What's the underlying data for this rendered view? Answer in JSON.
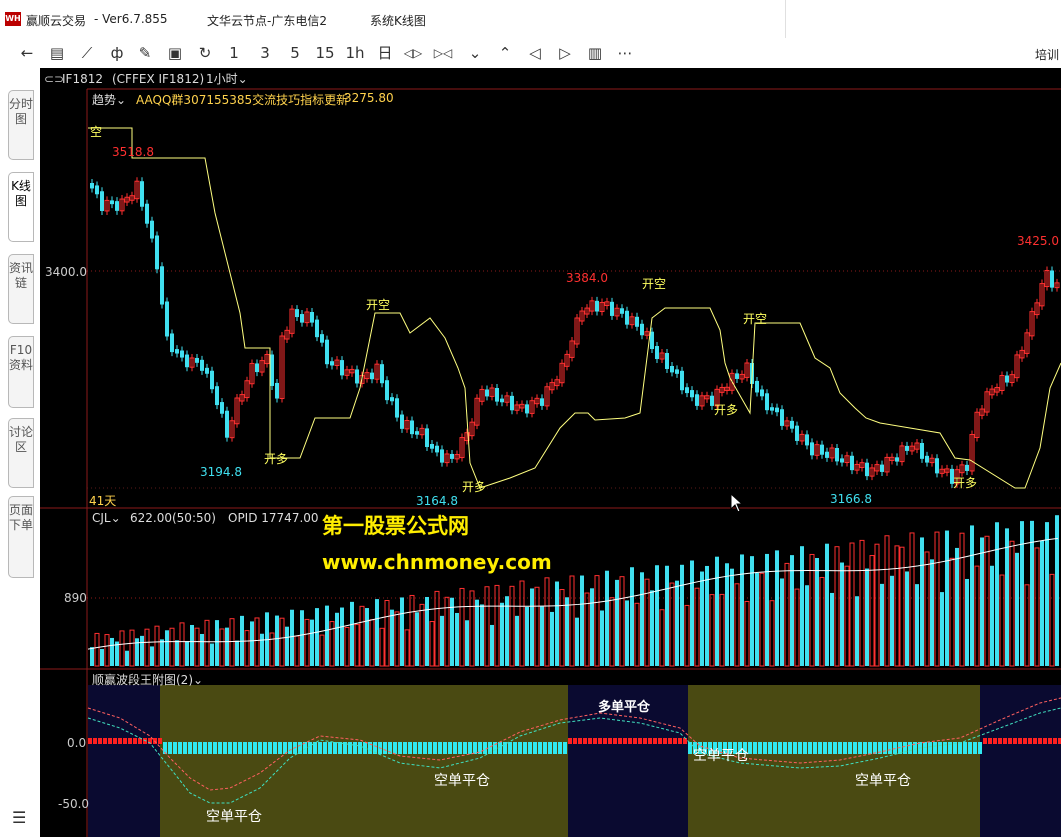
{
  "window": {
    "app_title": "赢顺云交易",
    "version_label": "-  Ver6.7.855",
    "node_label": "文华云节点-广东电信2",
    "system_label": "系统K线图",
    "logo_text": "WH"
  },
  "toolbar": {
    "buttons": [
      {
        "name": "back-arrow-icon",
        "label": "←"
      },
      {
        "name": "list-icon",
        "label": "▤"
      },
      {
        "name": "line-chart-icon",
        "label": "⟋"
      },
      {
        "name": "candlestick-icon",
        "label": "ф"
      },
      {
        "name": "draw-tool-icon",
        "label": "✎"
      },
      {
        "name": "save-icon",
        "label": "▣"
      },
      {
        "name": "refresh-icon",
        "label": "↻"
      },
      {
        "name": "period-1-button",
        "label": "1"
      },
      {
        "name": "period-3-button",
        "label": "3"
      },
      {
        "name": "period-5-button",
        "label": "5"
      },
      {
        "name": "period-15-button",
        "label": "15"
      },
      {
        "name": "period-1h-button",
        "label": "1h"
      },
      {
        "name": "period-day-button",
        "label": "日"
      },
      {
        "name": "zoom-out-icon",
        "label": "◁▷"
      },
      {
        "name": "zoom-in-icon",
        "label": "▷◁"
      },
      {
        "name": "chevron-down-icon",
        "label": "⌄"
      },
      {
        "name": "chevron-up-icon",
        "label": "⌃"
      },
      {
        "name": "prev-icon",
        "label": "◁"
      },
      {
        "name": "next-icon",
        "label": "▷"
      },
      {
        "name": "layout-icon",
        "label": "▥"
      },
      {
        "name": "more-icon",
        "label": "⋯"
      }
    ],
    "right_label": "培训"
  },
  "left_tabs": [
    {
      "label": "分时图",
      "active": false
    },
    {
      "label": "K线图",
      "active": true
    },
    {
      "label": "资讯链",
      "active": false
    },
    {
      "label": "F10资料",
      "active": false
    },
    {
      "label": "讨论区",
      "active": false
    },
    {
      "label": "页面下单",
      "active": false
    }
  ],
  "symbol_bar": {
    "code": "IF1812",
    "market": "(CFFEX IF1812)",
    "period": "1小时"
  },
  "main_panel": {
    "indicator": "趋势",
    "info": "AAQQ群307155385交流技巧指标更新",
    "value": "3275.80",
    "y_label": "3400.0",
    "period_count": "41天",
    "price_labels": [
      {
        "text": "3518.8",
        "color": "#ff3030"
      },
      {
        "text": "3194.8",
        "color": "#40e0f0"
      },
      {
        "text": "3164.8",
        "color": "#40e0f0"
      },
      {
        "text": "3384.0",
        "color": "#ff3030"
      },
      {
        "text": "3166.8",
        "color": "#40e0f0"
      },
      {
        "text": "3425.0",
        "color": "#ff3030"
      }
    ],
    "signals": [
      "空",
      "开多",
      "开空",
      "开多",
      "开空",
      "开多",
      "开空",
      "开多"
    ]
  },
  "volume_panel": {
    "indicator": "CJL",
    "value": "622.00(50:50)",
    "opid": "OPID 17747.00",
    "y_label": "890"
  },
  "sub_panel": {
    "indicator": "顺赢波段王附图(2)",
    "y_top": "0.0",
    "y_bottom": "-50.0",
    "labels": [
      "多单平仓",
      "空单平仓",
      "空单平仓",
      "空单平仓",
      "空单平仓"
    ]
  },
  "watermark": {
    "line1": "第一股票公式网",
    "line2": "www.chnmoney.com"
  },
  "colors": {
    "up": "#ff3030",
    "down": "#40e0f0",
    "signal": "#ffff60",
    "background": "#000000"
  }
}
